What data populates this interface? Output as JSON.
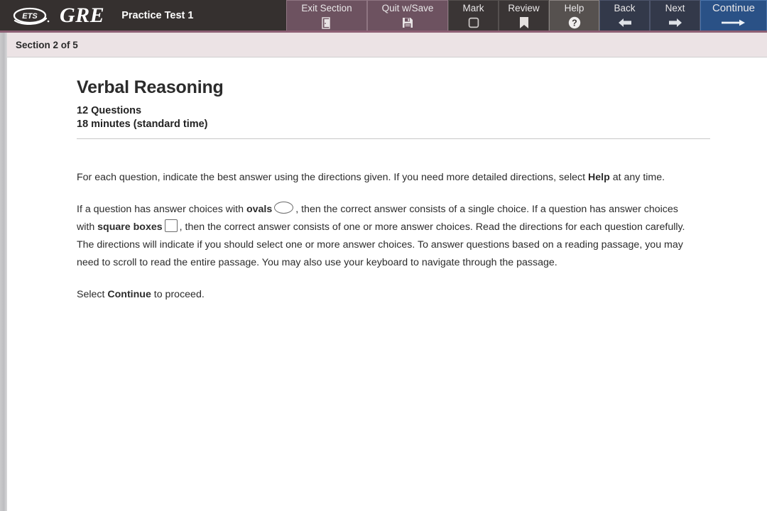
{
  "header": {
    "logo_text": "ETS",
    "brand": "GRE",
    "title": "Practice Test 1",
    "buttons": [
      {
        "label": "Exit Section",
        "icon": "exit-door-icon",
        "style": "mauve"
      },
      {
        "label": "Quit w/Save",
        "icon": "floppy-disk-save-icon",
        "style": "mauve"
      },
      {
        "label": "Mark",
        "icon": "checkbox-empty-icon",
        "style": "plain"
      },
      {
        "label": "Review",
        "icon": "bookmark-icon",
        "style": "plain"
      },
      {
        "label": "Help",
        "icon": "question-mark-circle-icon",
        "style": "help"
      },
      {
        "label": "Back",
        "icon": "arrow-left-icon",
        "style": "navy"
      },
      {
        "label": "Next",
        "icon": "arrow-right-icon",
        "style": "navy"
      },
      {
        "label": "Continue",
        "icon": "long-arrow-right-icon",
        "style": "continue"
      }
    ]
  },
  "section_bar": {
    "text": "Section 2 of 5"
  },
  "main": {
    "title": "Verbal Reasoning",
    "question_count": "12 Questions",
    "time_limit": "18 minutes (standard time)",
    "paragraph_1": {
      "part_a": "For each question, indicate the best answer using the directions given. If you need more detailed directions, select ",
      "bold_1": "Help",
      "part_b": " at any time."
    },
    "paragraph_2": {
      "part_a": "If a question has answer choices with ",
      "bold_1": "ovals",
      "part_b": ", then the correct answer consists of a single choice. If a question has answer choices with ",
      "bold_2": "square boxes",
      "part_c": ", then the correct answer consists of one or more answer choices. Read the directions for each question carefully. The directions will indicate if you should select one or more answer choices. To answer questions based on a reading passage, you may need to scroll to read the entire passage. You may also use your keyboard to navigate through the passage."
    },
    "paragraph_3": {
      "part_a": "Select ",
      "bold_1": "Continue",
      "part_b": " to proceed."
    }
  },
  "colors": {
    "toolbar_bg": "#35302f",
    "toolbar_border": "#8d5f74",
    "mauve_button": "#6d5260",
    "navy_button": "#33394a",
    "continue_button": "#2a5186",
    "section_bar_bg": "#ece3e5",
    "page_bg": "#ffffff",
    "text": "#2c2c2c"
  }
}
